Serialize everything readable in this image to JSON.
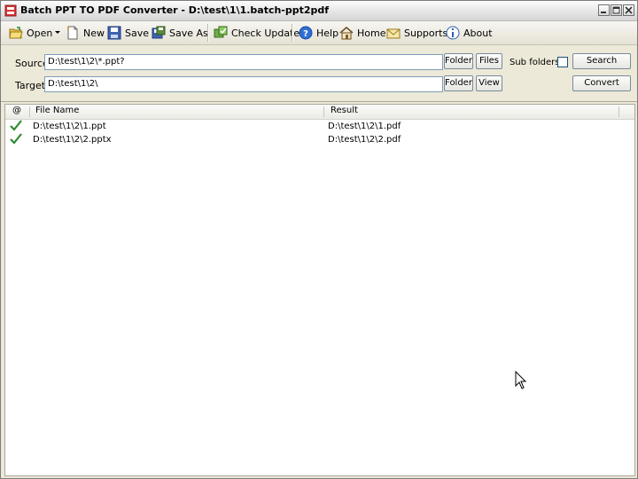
{
  "window": {
    "title": "Batch PPT TO PDF Converter - D:\\test\\1\\1.batch-ppt2pdf"
  },
  "toolbar": {
    "open": "Open",
    "new": "New",
    "save": "Save",
    "save_as": "Save As",
    "check_update": "Check Update",
    "help": "Help",
    "home": "Home",
    "supports": "Supports",
    "about": "About"
  },
  "form": {
    "source_label": "Source",
    "source_value": "D:\\test\\1\\2\\*.ppt?",
    "target_label": "Target",
    "target_value": "D:\\test\\1\\2\\",
    "folder_button": "Folder",
    "files_button": "Files",
    "view_button": "View",
    "subfolders_label": "Sub folders",
    "subfolders_checked": false,
    "search_button": "Search",
    "convert_button": "Convert"
  },
  "list": {
    "columns": [
      "@",
      "File Name",
      "Result"
    ],
    "rows": [
      {
        "status": "check-icon",
        "file": "D:\\test\\1\\2\\1.ppt",
        "result": "D:\\test\\1\\2\\1.pdf"
      },
      {
        "status": "check-icon",
        "file": "D:\\test\\1\\2\\2.pptx",
        "result": "D:\\test\\1\\2\\2.pdf"
      }
    ]
  },
  "colors": {
    "check": "#2e8b2e",
    "field_border": "#7f9db9"
  }
}
